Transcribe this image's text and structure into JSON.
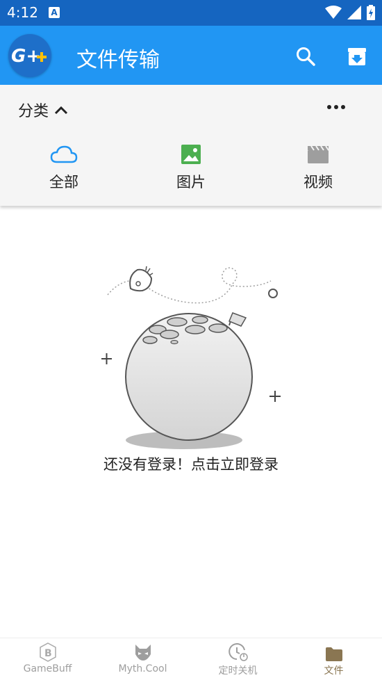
{
  "status_bar": {
    "time": "4:12",
    "notification_icon": "a-icon",
    "icons": [
      "wifi-icon",
      "signal-icon",
      "battery-icon"
    ]
  },
  "app_bar": {
    "logo_text": "G++",
    "title": "文件传输",
    "actions": [
      "search-icon",
      "archive-download-icon"
    ],
    "color": "#2196f3"
  },
  "category_panel": {
    "label": "分类",
    "tabs": [
      {
        "label": "全部",
        "icon": "cloud-icon",
        "color": "#2196f3"
      },
      {
        "label": "图片",
        "icon": "image-icon",
        "color": "#4caf50"
      },
      {
        "label": "视频",
        "icon": "video-icon",
        "color": "#9e9e9e"
      }
    ]
  },
  "empty_state": {
    "message": "还没有登录！点击立即登录"
  },
  "bottom_nav": {
    "items": [
      {
        "label": "GameBuff",
        "icon": "gamebuff-icon",
        "active": false
      },
      {
        "label": "Myth.Cool",
        "icon": "fox-mask-icon",
        "active": false
      },
      {
        "label": "定时关机",
        "icon": "timer-icon",
        "active": false
      },
      {
        "label": "文件",
        "icon": "folder-icon",
        "active": true
      }
    ],
    "active_color": "#8a7652"
  }
}
